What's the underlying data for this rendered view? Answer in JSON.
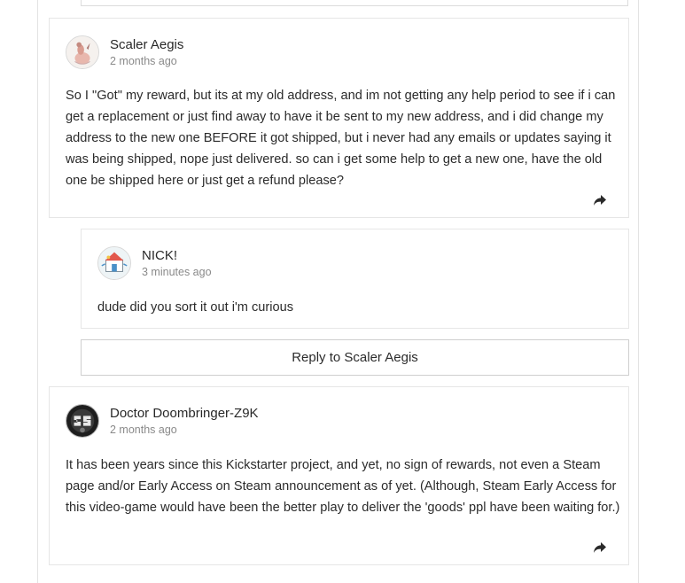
{
  "comments": [
    {
      "author": "Scaler Aegis",
      "time": "2 months ago",
      "text": "So I \"Got\" my reward, but its at my old address, and im not getting any help period to see if i can get a replacement or just find away to have it be sent to my new address, and i did change my address to the new one BEFORE it got shipped, but i never had any emails or updates saying it was being shipped, nope just delivered. so can i get some help to get a new one, have the old one be shipped here or just get a refund please?",
      "share_icon": "share-icon",
      "replies": [
        {
          "author": "NICK!",
          "time": "3 minutes ago",
          "text": "dude did you sort it out i'm curious"
        }
      ],
      "reply_button": "Reply to Scaler Aegis"
    },
    {
      "author": "Doctor Doombringer-Z9K",
      "time": "2 months ago",
      "text": "It has been years since this Kickstarter project, and yet, no sign of rewards, not even a Steam page and/or Early Access on Steam announcement as of yet. (Although, Steam Early Access for this video-game would have been the better play to deliver the 'goods' ppl have been waiting for.)",
      "share_icon": "share-icon"
    }
  ]
}
